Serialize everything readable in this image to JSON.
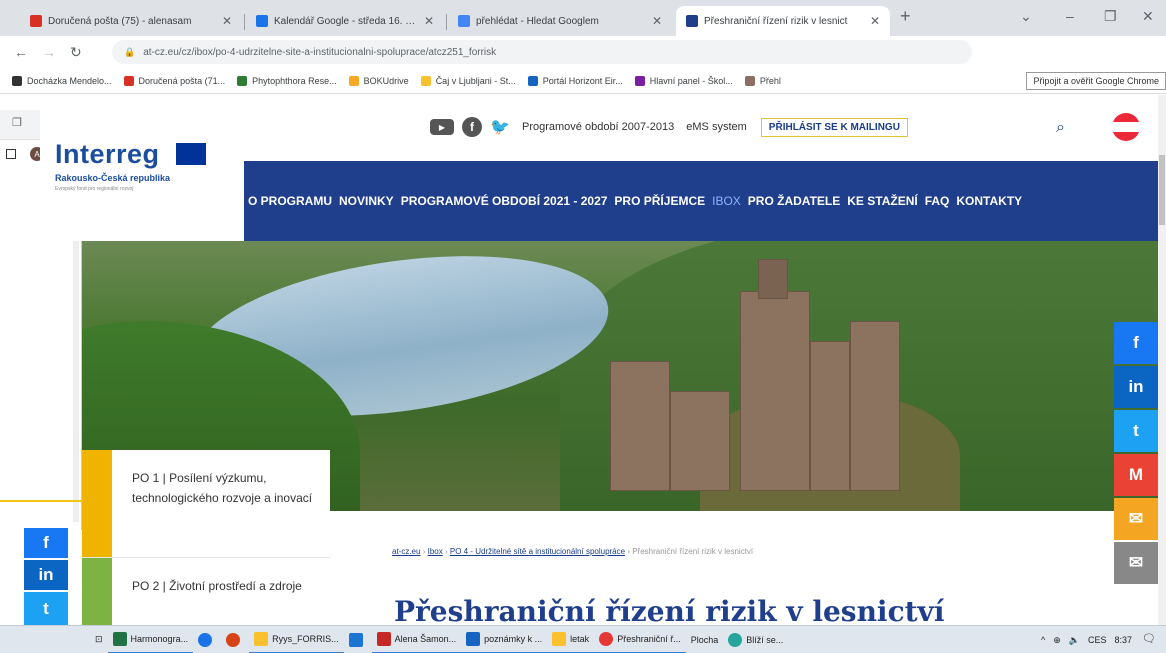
{
  "browser": {
    "tabs": [
      {
        "label": "Doručená pošta (75) - alenasam",
        "color": "#d93025"
      },
      {
        "label": "Kalendář Google - středa 16. čer",
        "color": "#1a73e8"
      },
      {
        "label": "přehlédat - Hledat Googlem",
        "color": "#4285f4"
      },
      {
        "label": "Přeshraniční řízení rizik v lesnict",
        "color": "#1f3e8c"
      }
    ],
    "new_tab": "+",
    "url": "at-cz.eu/cz/ibox/po-4-udrzitelne-site-a-institucionalni-spoluprace/atcz251_forrisk",
    "bookmarks": [
      {
        "label": "Docházka Mendelo...",
        "color": "#333"
      },
      {
        "label": "Doručená pošta (71...",
        "color": "#d93025"
      },
      {
        "label": "Phytophthora Rese...",
        "color": "#2e7d32"
      },
      {
        "label": "BOKUdrive",
        "color": "#f9a825"
      },
      {
        "label": "Čaj v Ljubljani - St...",
        "color": "#fbc02d"
      },
      {
        "label": "Portál Horizont Eir...",
        "color": "#1565c0"
      },
      {
        "label": "Hlavní panel - Škol...",
        "color": "#7b1fa2"
      },
      {
        "label": "Přehl",
        "color": "#8d6e63"
      }
    ],
    "tooltip": "Připojit a ověřit Google Chrome"
  },
  "site": {
    "logo_word": "Interreg",
    "logo_sub": "Rakousko-Česká republika",
    "logo_tiny": "Evropský fond pro regionální rozvoj",
    "top_links": {
      "period": "Programové období 2007-2013",
      "ems": "eMS system",
      "mailing": "PŘIHLÁSIT SE K MAILINGU"
    },
    "nav": [
      {
        "label": "O PROGRAMU",
        "selected": false
      },
      {
        "label": "NOVINKY",
        "selected": false
      },
      {
        "label": "PROGRAMOVÉ OBDOBÍ 2021 - 2027",
        "selected": false
      },
      {
        "label": "PRO PŘÍJEMCE",
        "selected": false
      },
      {
        "label": "IBOX",
        "selected": true
      },
      {
        "label": "PRO ŽADATELE",
        "selected": false
      },
      {
        "label": "KE STAŽENÍ",
        "selected": false
      },
      {
        "label": "FAQ",
        "selected": false
      },
      {
        "label": "KONTAKTY",
        "selected": false
      }
    ],
    "cards": [
      {
        "text": "PO 1 | Posílení výzkumu, technologického rozvoje a inovací",
        "color": "#f0b400"
      },
      {
        "text": "PO 2 | Životní prostředí a zdroje",
        "color": "#7cb342"
      }
    ],
    "breadcrumb": {
      "home": "at-cz.eu",
      "ibox": "Ibox",
      "po4": "PO 4 - Udržitelné sítě a institucionální spolupráce",
      "current": "Přeshraniční řízení rizik v lesnictví",
      "sep": "›"
    },
    "title": "Přeshraniční řízení rizik v lesnictví",
    "social_right": [
      {
        "icon": "f",
        "name": "facebook-share",
        "color": "#1877f2"
      },
      {
        "icon": "in",
        "name": "linkedin-share",
        "color": "#0a66c2"
      },
      {
        "icon": "t",
        "name": "twitter-share",
        "color": "#1da1f2"
      },
      {
        "icon": "M",
        "name": "gmail-share",
        "color": "#ea4335"
      },
      {
        "icon": "✉",
        "name": "email-share",
        "color": "#f4a623"
      },
      {
        "icon": "✉",
        "name": "mail-share",
        "color": "#888888"
      }
    ],
    "social_left": [
      {
        "icon": "f",
        "color": "#1877f2"
      },
      {
        "icon": "in",
        "color": "#0a66c2"
      },
      {
        "icon": "t",
        "color": "#1da1f2"
      }
    ]
  },
  "taskbar": {
    "items": [
      {
        "label": "Harmonogra...",
        "color": "#217346"
      },
      {
        "label": "",
        "color": "#1a73e8"
      },
      {
        "label": "",
        "color": "#d84315"
      },
      {
        "label": "Ryys_FORRIS...",
        "color": "#fbc02d"
      },
      {
        "label": "",
        "color": "#1976d2"
      },
      {
        "label": "Alena Šamon...",
        "color": "#c62828"
      },
      {
        "label": "poznámky k ...",
        "color": "#1565c0"
      },
      {
        "label": "letak",
        "color": "#fbc02d"
      },
      {
        "label": "Přeshraniční ř...",
        "color": "#e53935"
      }
    ],
    "desktop": "Plocha",
    "weather": "Blíží se...",
    "lang": "CES",
    "time": "8:37"
  }
}
